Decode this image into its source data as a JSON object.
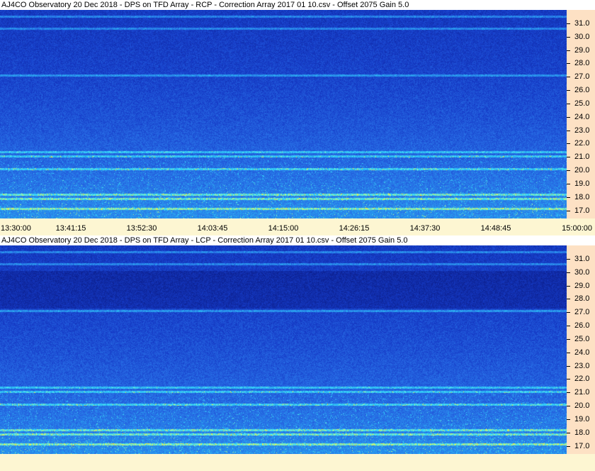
{
  "chart_data": [
    {
      "type": "heatmap",
      "title": "AJ4CO Observatory 20 Dec 2018  -  DPS on TFD Array  -  RCP  -  Correction Array 2017 01 10.csv  -  Offset 2075  Gain 5.0",
      "ylabel": "",
      "xlabel": "",
      "ylim": [
        16.4,
        32.0
      ],
      "yticks": [
        "31.0",
        "30.0",
        "29.0",
        "28.0",
        "27.0",
        "26.0",
        "25.0",
        "24.0",
        "23.0",
        "22.0",
        "21.0",
        "20.0",
        "19.0",
        "18.0",
        "17.0"
      ],
      "xticks": [
        "13:30:00",
        "13:41:15",
        "13:52:30",
        "14:03:45",
        "14:15:00",
        "14:26:15",
        "14:37:30",
        "14:48:45",
        "15:00:00"
      ],
      "xrange": [
        "13:30:00",
        "15:00:00"
      ],
      "bright_bands_mhz": [
        17.15,
        17.9,
        18.2,
        20.1,
        21.05,
        21.4,
        27.1,
        30.6,
        31.5
      ]
    },
    {
      "type": "heatmap",
      "title": "AJ4CO Observatory 20 Dec 2018  -  DPS on TFD Array  -  LCP  -  Correction Array 2017 01 10.csv  -  Offset 2075  Gain 5.0",
      "ylabel": "",
      "xlabel": "",
      "ylim": [
        16.4,
        32.0
      ],
      "yticks": [
        "31.0",
        "30.0",
        "29.0",
        "28.0",
        "27.0",
        "26.0",
        "25.0",
        "24.0",
        "23.0",
        "22.0",
        "21.0",
        "20.0",
        "19.0",
        "18.0",
        "17.0"
      ],
      "xticks": [],
      "xrange": [
        "13:30:00",
        "15:00:00"
      ],
      "bright_bands_mhz": [
        17.15,
        17.9,
        18.2,
        20.1,
        21.05,
        21.4,
        27.1,
        30.6,
        31.5
      ]
    }
  ],
  "colors": {
    "background": "#fdf6d2",
    "axis_panel": "#fde1c4",
    "low": "#0a1e8c",
    "mid": "#2a6bd8",
    "high": "#3fe0ff",
    "peak": "#ffe030"
  }
}
